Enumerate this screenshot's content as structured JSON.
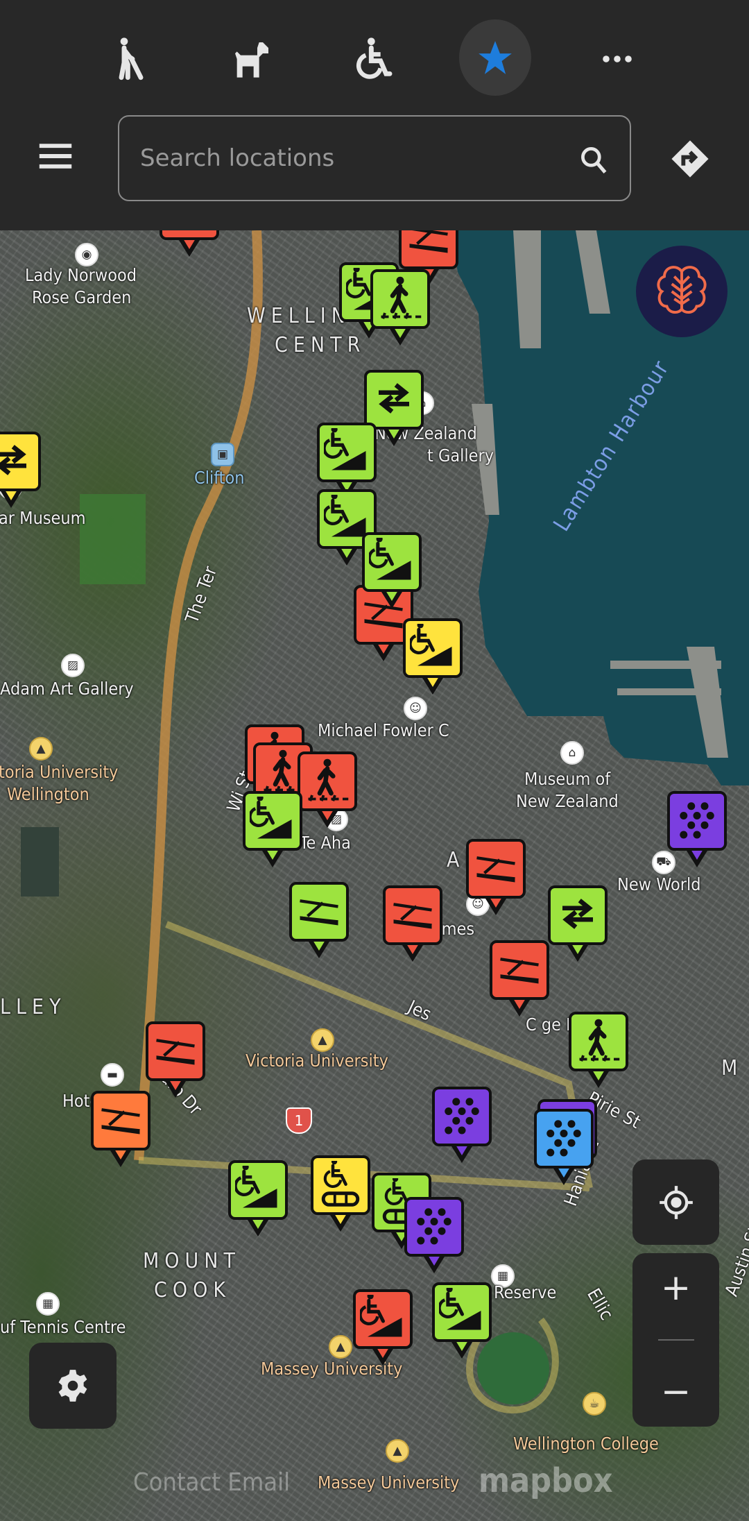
{
  "header": {
    "filters": [
      {
        "name": "blind-cane-icon",
        "label": "Low vision"
      },
      {
        "name": "service-dog-icon",
        "label": "Service dog"
      },
      {
        "name": "wheelchair-icon",
        "label": "Wheelchair"
      },
      {
        "name": "star-icon",
        "label": "Favourites",
        "active": true,
        "color": "#1e7ddc"
      },
      {
        "name": "more-icon",
        "label": "More"
      }
    ],
    "search": {
      "placeholder": "Search locations",
      "value": ""
    }
  },
  "map": {
    "labels": {
      "lady_norwood_1": "Lady Norwood",
      "lady_norwood_2": "Rose Garden",
      "wellington_central_1": "WELLIN",
      "wellington_central_2": "CENTR",
      "nz_portrait_1": "New Zealand",
      "nz_portrait_2": "t Gallery",
      "clifton": "Clifton",
      "lambton": "Lambton Harbour",
      "museum_left": "ar Museum",
      "the_ter": "The Ter",
      "adam_art": "Adam Art Gallery",
      "victoria_uni_1": "toria University",
      "victoria_uni_2": "Wellington",
      "michael_fowler": "Michael Fowler C",
      "te_papa_1": "Museum of",
      "te_papa_2": "New Zealand",
      "willis_st": "Wi   St",
      "te_aro": "ARO",
      "te_ahaha": "Te Aha",
      "new_world": "New World",
      "st_james": "St James",
      "valley": "LLEY",
      "jess": "Jes",
      "college_hotel": "C     ge Hotel",
      "karo_dr": "Karo Dr",
      "victoria_uni_3": "Victoria University",
      "hotel_willis": "Hotel Willis",
      "pirie_st": "Pirie St",
      "hania_st": "Hania St",
      "mount_cook_1": "MOUNT",
      "mount_cook_2": "COOK",
      "reserve": "Reserve",
      "ellice": "Ellic",
      "austin_st": "Austin St",
      "mt_vic": "M\nVIC",
      "tennis": "uf Tennis Centre",
      "massey_1": "Massey University",
      "massey_2": "Massey University",
      "wellington_college": "Wellington College",
      "highway": "1"
    },
    "attribution": {
      "contact": "Contact Email",
      "logo": "mapbox"
    },
    "marker_colors": {
      "red": "#f0533f",
      "green": "#9de33f",
      "yellow": "#ffe33d",
      "orange": "#ff7a3c",
      "purple": "#7b3ee0",
      "blue": "#47a2f0"
    },
    "markers": [
      {
        "color": "red",
        "icon": "ramp"
      },
      {
        "color": "red",
        "icon": "ramp"
      },
      {
        "color": "green",
        "icon": "wheelchair-ramp"
      },
      {
        "color": "green",
        "icon": "pedestrian-crossing"
      },
      {
        "color": "yellow",
        "icon": "two-way-arrows"
      },
      {
        "color": "green",
        "icon": "two-way-arrows"
      },
      {
        "color": "green",
        "icon": "wheelchair-ramp"
      },
      {
        "color": "green",
        "icon": "wheelchair-ramp"
      },
      {
        "color": "red",
        "icon": "ramp"
      },
      {
        "color": "green",
        "icon": "wheelchair-ramp"
      },
      {
        "color": "yellow",
        "icon": "wheelchair-ramp"
      },
      {
        "color": "red",
        "icon": "pedestrian-crossing"
      },
      {
        "color": "red",
        "icon": "pedestrian-crossing"
      },
      {
        "color": "red",
        "icon": "pedestrian-crossing"
      },
      {
        "color": "red",
        "icon": "ramp"
      },
      {
        "color": "green",
        "icon": "wheelchair-ramp"
      },
      {
        "color": "purple",
        "icon": "tactile-dots"
      },
      {
        "color": "green",
        "icon": "ramp"
      },
      {
        "color": "red",
        "icon": "ramp"
      },
      {
        "color": "green",
        "icon": "two-way-arrows"
      },
      {
        "color": "red",
        "icon": "ramp"
      },
      {
        "color": "green",
        "icon": "pedestrian-crossing"
      },
      {
        "color": "red",
        "icon": "ramp"
      },
      {
        "color": "orange",
        "icon": "ramp"
      },
      {
        "color": "purple",
        "icon": "tactile-dots"
      },
      {
        "color": "purple",
        "icon": "tactile-dots"
      },
      {
        "color": "blue",
        "icon": "tactile-dots"
      },
      {
        "color": "green",
        "icon": "wheelchair-ramp"
      },
      {
        "color": "yellow",
        "icon": "wheelchair-conveyor"
      },
      {
        "color": "green",
        "icon": "wheelchair-conveyor"
      },
      {
        "color": "purple",
        "icon": "tactile-dots"
      },
      {
        "color": "red",
        "icon": "wheelchair-ramp"
      },
      {
        "color": "green",
        "icon": "wheelchair-ramp"
      }
    ]
  },
  "controls": {
    "logo": "brain-logo-icon",
    "locate": "locate-icon",
    "zoom_in": "+",
    "zoom_out": "−",
    "settings": "gear-icon",
    "menu": "hamburger-icon",
    "directions": "directions-icon"
  }
}
